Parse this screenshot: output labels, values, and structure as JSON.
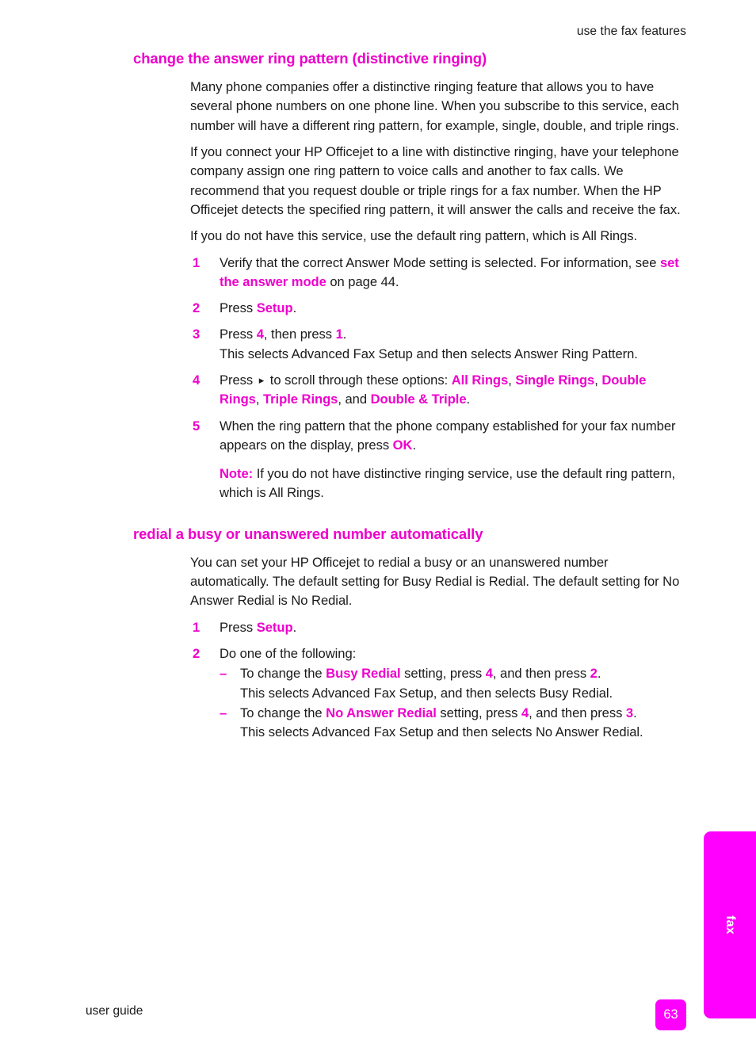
{
  "header": {
    "running_head": "use the fax features"
  },
  "sections": [
    {
      "heading": "change the answer ring pattern (distinctive ringing)",
      "paragraphs": [
        "Many phone companies offer a distinctive ringing feature that allows you to have several phone numbers on one phone line. When you subscribe to this service, each number will have a different ring pattern, for example, single, double, and triple rings.",
        "If you connect your HP Officejet to a line with distinctive ringing, have your telephone company assign one ring pattern to voice calls and another to fax calls. We recommend that you request double or triple rings for a fax number. When the HP Officejet detects the specified ring pattern, it will answer the calls and receive the fax.",
        "If you do not have this service, use the default ring pattern, which is All Rings."
      ],
      "steps": [
        {
          "number": "1",
          "text_before": "Verify that the correct Answer Mode setting is selected. For information, see ",
          "link": "set the answer mode",
          "text_after": " on page 44."
        },
        {
          "number": "2",
          "text_before": "Press ",
          "emphasis": "Setup",
          "text_after": "."
        },
        {
          "number": "3",
          "text_before": "Press ",
          "key1": "4",
          "text_mid": ", then press ",
          "key2": "1",
          "text_after": ".",
          "continuation": "This selects Advanced Fax Setup and then selects Answer Ring Pattern."
        },
        {
          "number": "4",
          "text_before": "Press ",
          "arrow_icon": "▸",
          "text_mid": " to scroll through these options: ",
          "options": [
            "All Rings",
            "Single Rings",
            "Double Rings",
            "Triple Rings",
            "Double & Triple"
          ],
          "text_after": "."
        },
        {
          "number": "5",
          "text_before": "When the ring pattern that the phone company established for your fax number appears on the display, press ",
          "emphasis": "OK",
          "text_after": "."
        }
      ],
      "note": {
        "label": "Note:",
        "text": " If you do not have distinctive ringing service, use the default ring pattern, which is All Rings."
      }
    },
    {
      "heading": "redial a busy or unanswered number automatically",
      "paragraphs": [
        "You can set your HP Officejet to redial a busy or an unanswered number automatically. The default setting for Busy Redial is Redial. The default setting for No Answer Redial is No Redial."
      ],
      "steps": [
        {
          "number": "1",
          "text_before": "Press ",
          "emphasis": "Setup",
          "text_after": "."
        },
        {
          "number": "2",
          "text_before": "Do one of the following:",
          "sublist": [
            {
              "dash": "–",
              "text_before": "To change the ",
              "emphasis": "Busy Redial",
              "text_mid": " setting, press ",
              "key1": "4",
              "text_mid2": ", and then press ",
              "key2": "2",
              "text_after": ".",
              "continuation": "This selects Advanced Fax Setup, and then selects Busy Redial."
            },
            {
              "dash": "–",
              "text_before": "To change the ",
              "emphasis": "No Answer Redial",
              "text_mid": " setting, press ",
              "key1": "4",
              "text_mid2": ", and then press ",
              "key2": "3",
              "text_after": ".",
              "continuation": "This selects Advanced Fax Setup and then selects No Answer Redial."
            }
          ]
        }
      ]
    }
  ],
  "side_tab": {
    "label": "fax"
  },
  "footer": {
    "guide_label": "user guide",
    "page_number": "63"
  },
  "colors": {
    "accent_magenta": "#ee00cc",
    "tab_magenta": "#ff00ff",
    "body_text": "#1a1a1a"
  }
}
